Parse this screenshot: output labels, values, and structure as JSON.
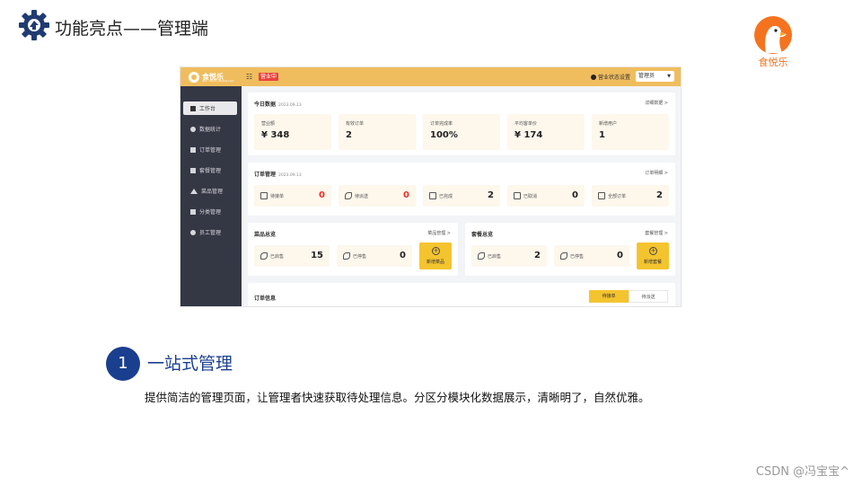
{
  "slide": {
    "title": "功能亮点——管理端",
    "logo_text": "食悦乐",
    "point_number": "1",
    "point_title": "一站式管理",
    "point_desc": "提供简洁的管理页面，让管理者快速获取待处理信息。分区分模块化数据展示，清晰明了，自然优雅。",
    "watermark": "CSDN @冯宝宝^",
    "colors": {
      "title_blue": "#1a3f8f",
      "logo_orange": "#f5731f",
      "accent_yellow": "#f0bd5e"
    }
  },
  "admin": {
    "brand_name": "食悦乐",
    "brand_sub": "Ohh Yummy Restaurant",
    "status_badge": "营业中",
    "shop_setting": "营业状态设置",
    "user_label": "管理员",
    "sidebar": [
      {
        "label": "工作台",
        "icon": "home-icon",
        "active": true
      },
      {
        "label": "数据统计",
        "icon": "chart-icon"
      },
      {
        "label": "订单管理",
        "icon": "order-icon"
      },
      {
        "label": "套餐管理",
        "icon": "setmeal-icon"
      },
      {
        "label": "菜品管理",
        "icon": "dish-icon"
      },
      {
        "label": "分类管理",
        "icon": "category-icon"
      },
      {
        "label": "员工管理",
        "icon": "employee-icon"
      }
    ],
    "today": {
      "title": "今日数据",
      "date": "2023.09.13",
      "link": "详细数据 >",
      "tiles": [
        {
          "label": "营业额",
          "value": "¥ 348"
        },
        {
          "label": "有效订单",
          "value": "2"
        },
        {
          "label": "订单完成率",
          "value": "100%"
        },
        {
          "label": "平均客单价",
          "value": "¥ 174"
        },
        {
          "label": "新增用户",
          "value": "1"
        }
      ]
    },
    "orders": {
      "title": "订单管理",
      "date": "2023.09.13",
      "link": "订单明细 >",
      "tiles": [
        {
          "label": "待接单",
          "value": "0",
          "highlight": true,
          "icon": "receipt-icon"
        },
        {
          "label": "待派送",
          "value": "0",
          "highlight": true,
          "icon": "delivery-icon"
        },
        {
          "label": "已完成",
          "value": "2",
          "highlight": false,
          "icon": "done-icon"
        },
        {
          "label": "已取消",
          "value": "0",
          "highlight": false,
          "icon": "cancel-icon"
        },
        {
          "label": "全部订单",
          "value": "2",
          "highlight": false,
          "icon": "list-icon"
        }
      ]
    },
    "dishes": {
      "title": "菜品总览",
      "link": "菜品管理 >",
      "on_label": "已启售",
      "on_value": "15",
      "off_label": "已停售",
      "off_value": "0",
      "add_label": "新增菜品"
    },
    "setmeals": {
      "title": "套餐总览",
      "link": "套餐管理 >",
      "on_label": "已启售",
      "on_value": "2",
      "off_label": "已停售",
      "off_value": "0",
      "add_label": "新增套餐"
    },
    "order_info": {
      "title": "订单信息",
      "tab_active": "待接单",
      "tab_other": "待派送"
    }
  }
}
